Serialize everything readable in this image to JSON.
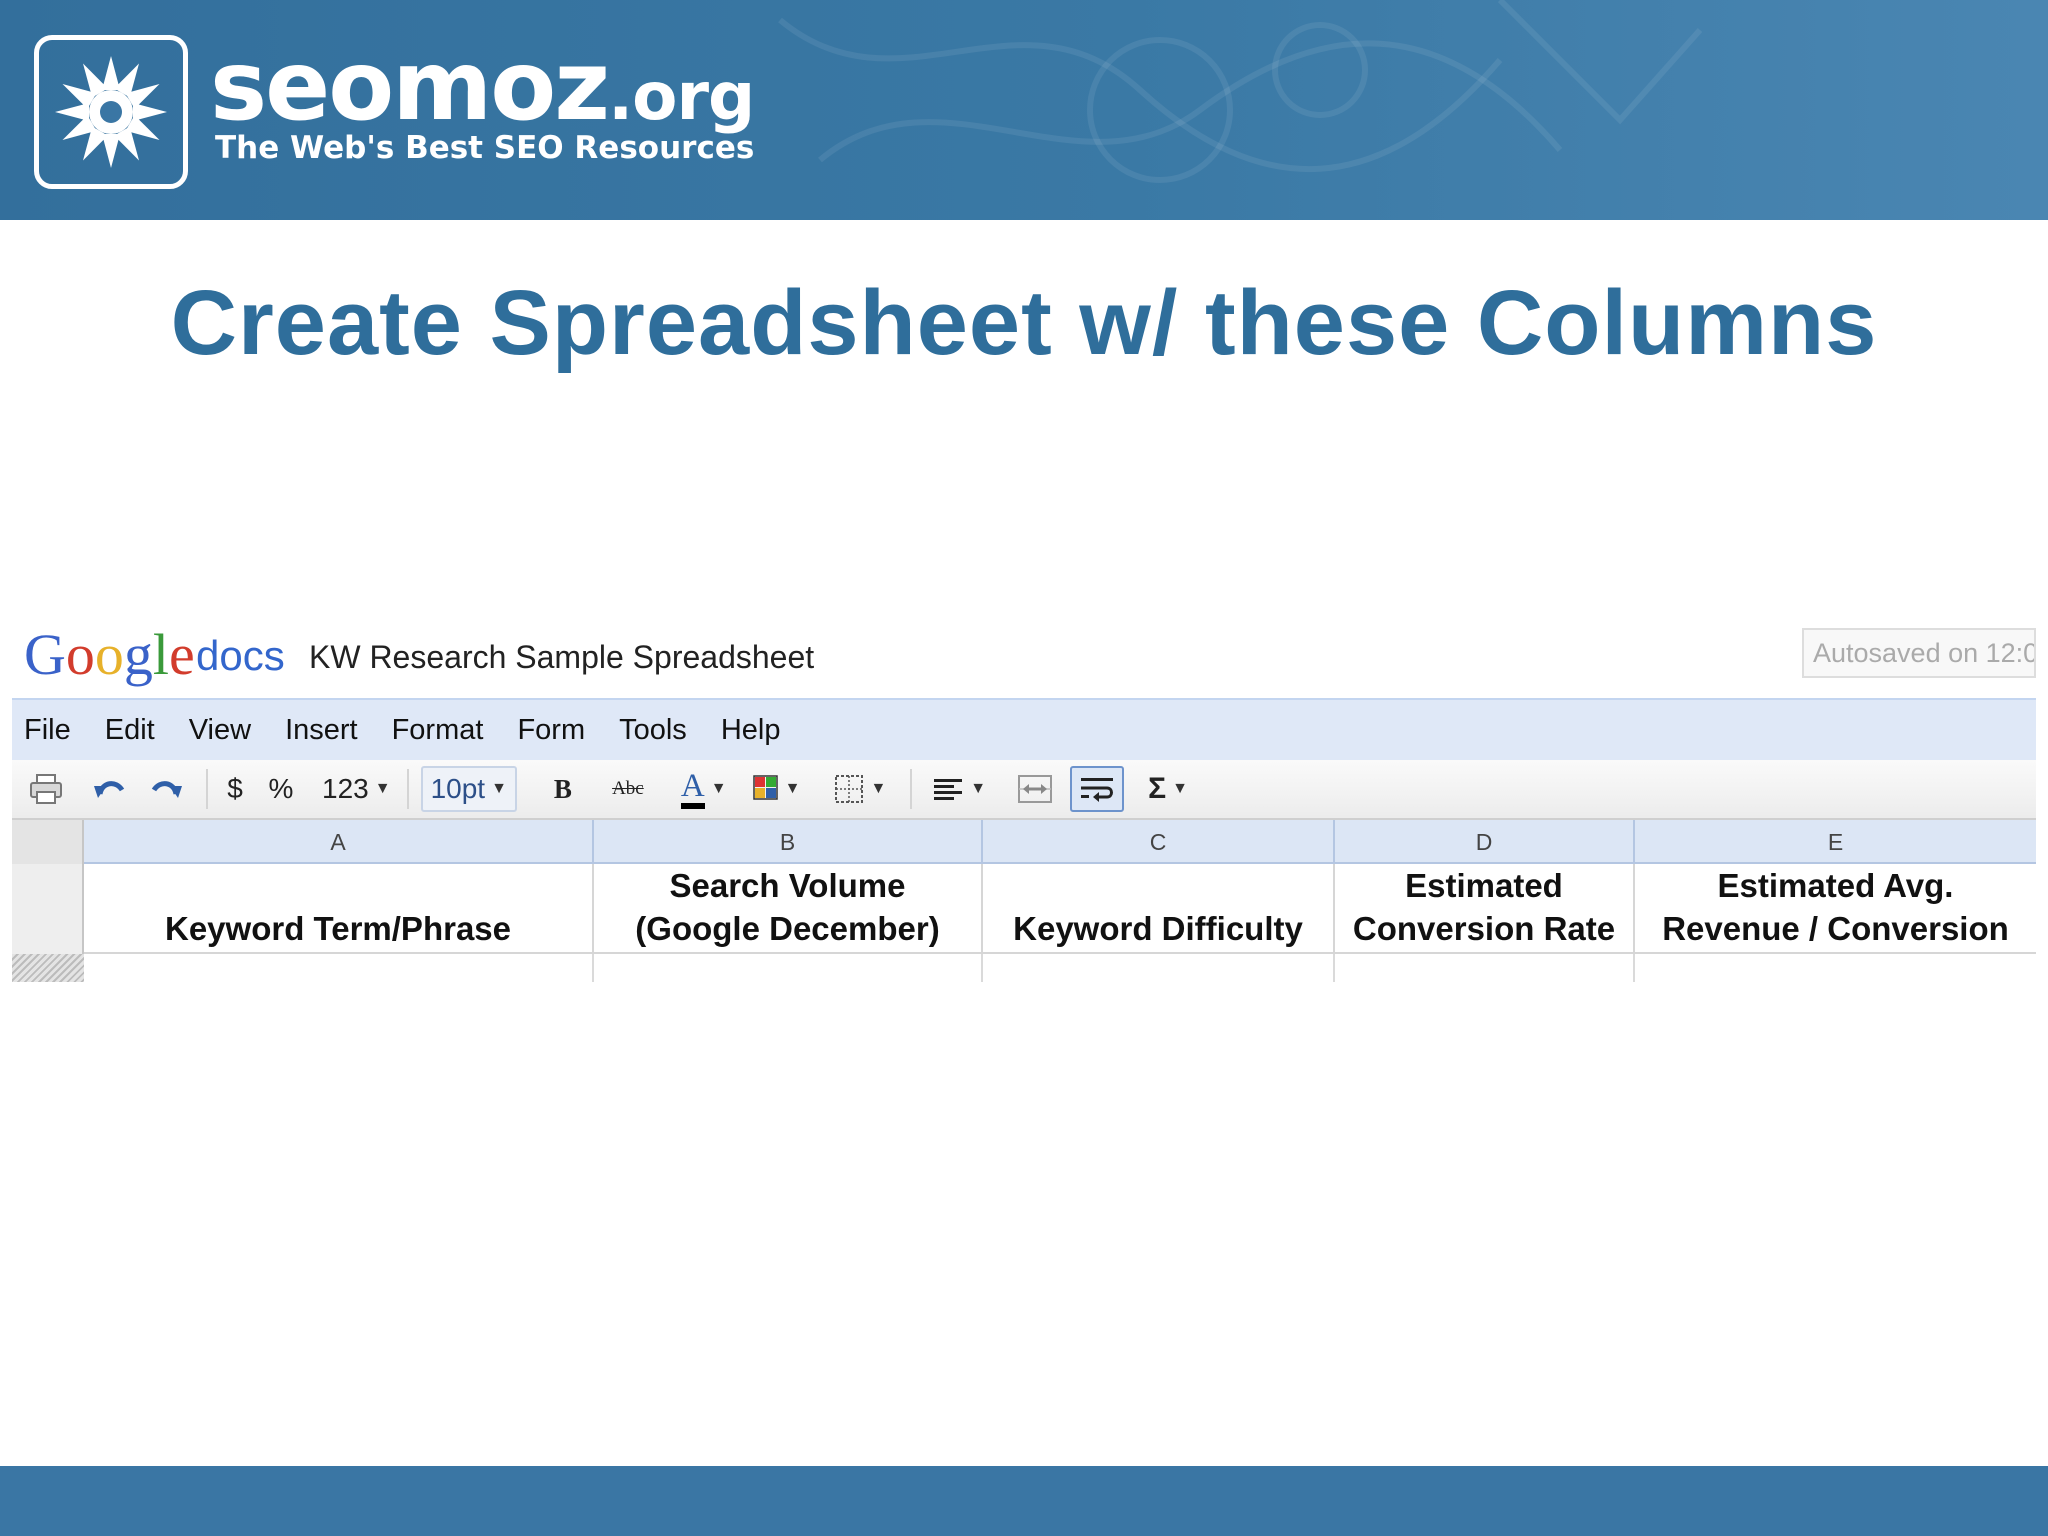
{
  "banner": {
    "brand_name": "seomoz",
    "brand_tld": ".org",
    "tagline": "The Web's Best SEO Resources",
    "logo_icon": "starburst-icon"
  },
  "slide": {
    "title": "Create Spreadsheet w/ these Columns"
  },
  "docs": {
    "logo_letters": [
      "G",
      "o",
      "o",
      "g",
      "l",
      "e"
    ],
    "logo_colors": [
      "#3a62c9",
      "#d23c2c",
      "#e7b12a",
      "#3a62c9",
      "#3a9a3a",
      "#d23c2c"
    ],
    "product": "docs",
    "doc_title": "KW Research Sample Spreadsheet",
    "autosave": "Autosaved on 12:0"
  },
  "menu": [
    "File",
    "Edit",
    "View",
    "Insert",
    "Format",
    "Form",
    "Tools",
    "Help"
  ],
  "toolbar": {
    "currency": "$",
    "percent": "%",
    "number_format": "123",
    "font_size": "10pt",
    "bold": "B",
    "strikethrough": "Abc",
    "text_color": "A",
    "sum": "Σ"
  },
  "sheet": {
    "columns": [
      {
        "letter": "A",
        "header_line1": "",
        "header_line2": "Keyword Term/Phrase"
      },
      {
        "letter": "B",
        "header_line1": "Search Volume",
        "header_line2": "(Google December)"
      },
      {
        "letter": "C",
        "header_line1": "",
        "header_line2": "Keyword Difficulty"
      },
      {
        "letter": "D",
        "header_line1": "Estimated",
        "header_line2": "Conversion Rate"
      },
      {
        "letter": "E",
        "header_line1": "Estimated Avg.",
        "header_line2": "Revenue / Conversion"
      }
    ]
  }
}
